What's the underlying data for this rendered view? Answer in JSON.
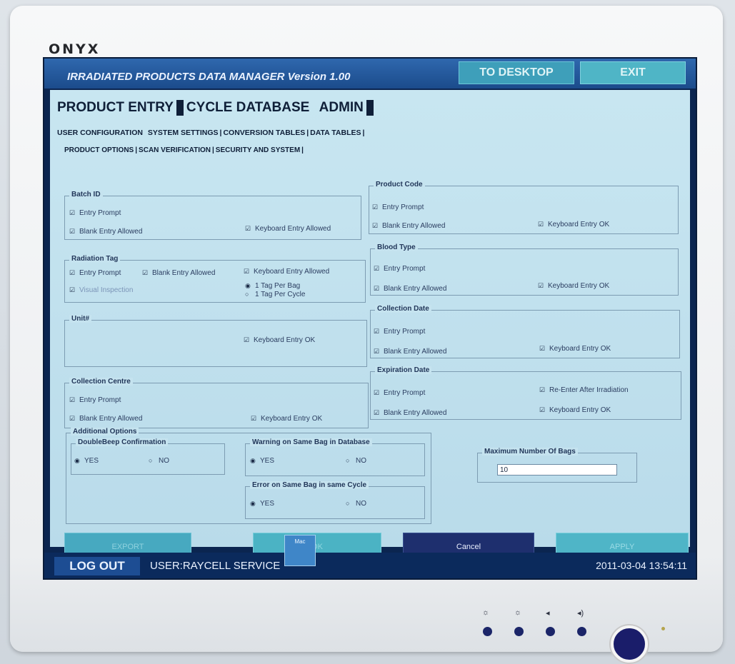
{
  "brand": "ONYX",
  "app": {
    "title": "IRRADIATED PRODUCTS DATA MANAGER Version 1.00",
    "to_desktop": "TO DESKTOP",
    "exit": "EXIT"
  },
  "main_tabs": [
    "PRODUCT ENTRY",
    "CYCLE DATABASE",
    "ADMIN"
  ],
  "sub_tabs": [
    "USER CONFIGURATION",
    "SYSTEM SETTINGS",
    "CONVERSION TABLES",
    "DATA TABLES"
  ],
  "sub_tabs2": [
    "PRODUCT OPTIONS",
    "SCAN VERIFICATION",
    "SECURITY AND SYSTEM"
  ],
  "groups": {
    "batch_id": {
      "legend": "Batch ID",
      "entry_prompt": "Entry Prompt",
      "blank_entry": "Blank Entry Allowed",
      "keyboard_entry": "Keyboard Entry Allowed"
    },
    "radiation_tag": {
      "legend": "Radiation Tag",
      "entry_prompt": "Entry Prompt",
      "blank_entry": "Blank Entry Allowed",
      "keyboard_entry": "Keyboard Entry Allowed",
      "visual_inspection": "Visual Inspection",
      "tag_per_bag": "1 Tag Per Bag",
      "tag_per_cycle": "1 Tag Per Cycle"
    },
    "unit": {
      "legend": "Unit#",
      "keyboard_ok": "Keyboard Entry OK"
    },
    "collection_centre": {
      "legend": "Collection Centre",
      "entry_prompt": "Entry Prompt",
      "blank_entry": "Blank Entry Allowed",
      "keyboard_ok": "Keyboard Entry OK"
    },
    "product_code": {
      "legend": "Product Code",
      "entry_prompt": "Entry Prompt",
      "blank_entry": "Blank Entry Allowed",
      "keyboard_ok": "Keyboard Entry OK"
    },
    "blood_type": {
      "legend": "Blood Type",
      "entry_prompt": "Entry Prompt",
      "blank_entry": "Blank Entry Allowed",
      "keyboard_ok": "Keyboard Entry OK"
    },
    "collection_date": {
      "legend": "Collection Date",
      "entry_prompt": "Entry Prompt",
      "blank_entry": "Blank Entry Allowed",
      "keyboard_ok": "Keyboard Entry OK"
    },
    "expiration_date": {
      "legend": "Expiration Date",
      "entry_prompt": "Entry Prompt",
      "re_enter": "Re-Enter After Irradiation",
      "blank_entry": "Blank Entry Allowed",
      "keyboard_ok": "Keyboard Entry OK"
    },
    "additional": {
      "legend": "Additional Options",
      "double_beep": "DoubleBeep Confirmation",
      "warning_same_bag": "Warning on Same Bag in Database",
      "error_same_bag": "Error on Same Bag in same Cycle",
      "yes": "YES",
      "no": "NO"
    },
    "max_bags": {
      "legend": "Maximum Number Of Bags",
      "value": "10"
    }
  },
  "buttons": {
    "export": "EXPORT",
    "ok": "OK",
    "cancel": "Cancel",
    "apply": "APPLY"
  },
  "footer": {
    "logout": "LOG OUT",
    "user": "USER:RAYCELL SERVICE",
    "datetime": "2011-03-04 13:54:11"
  },
  "mac_icon_label": "Mac"
}
